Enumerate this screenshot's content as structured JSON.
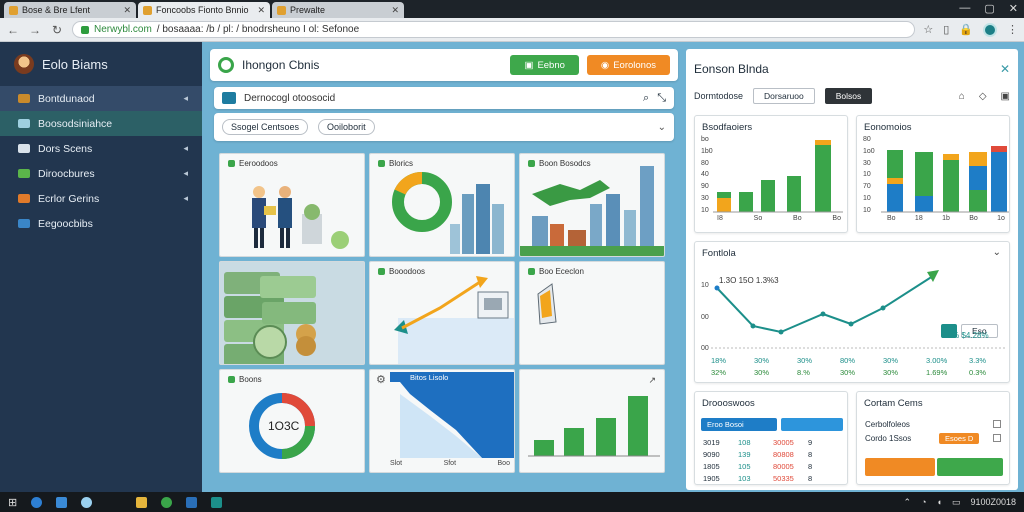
{
  "browser": {
    "tabs": [
      {
        "title": "Bose & Bre Lfent",
        "active": false
      },
      {
        "title": "Foncoobs Fionto Bnnio",
        "active": true
      },
      {
        "title": "Prewalte",
        "active": false
      }
    ],
    "url_host": "Nerwybl.com",
    "url_path": "/ bosaaaa: /b / pl: / bnodrsheuno I ol: Sefonoe"
  },
  "sidebar": {
    "brand": "Eolo Biams",
    "items": [
      {
        "label": "Bontdunaod",
        "icon_color": "#c98a2b",
        "state": "active",
        "chevron": true
      },
      {
        "label": "Boosodsiniahce",
        "icon_color": "#9fd0e0",
        "state": "selected",
        "chevron": false
      },
      {
        "label": "Dors Scens",
        "icon_color": "#d9e2ea",
        "state": "normal",
        "chevron": true
      },
      {
        "label": "Diroocbures",
        "icon_color": "#5bb54a",
        "state": "normal",
        "chevron": true
      },
      {
        "label": "Ecrlor Gerins",
        "icon_color": "#e07a2a",
        "state": "normal",
        "chevron": true
      },
      {
        "label": "Eegoocbibs",
        "icon_color": "#3a86c8",
        "state": "normal",
        "chevron": false
      }
    ]
  },
  "center": {
    "title": "Ihongon Cbnis",
    "btn_green": "Eebno",
    "btn_orange": "Eorolonos",
    "search_text": "Dernocogl otoosocid",
    "chips": [
      "Ssogel Centsoes",
      "Ooiloborit"
    ],
    "tiles": [
      {
        "label": "Eeroodoos"
      },
      {
        "label": "Blorics"
      },
      {
        "label": "Boon Bosodcs"
      },
      {
        "label": ""
      },
      {
        "label": "Booodoos"
      },
      {
        "label": "Boo Ececlon"
      },
      {
        "label": "Boons"
      },
      {
        "label": "Bitos Lisolo"
      },
      {
        "label": ""
      }
    ],
    "donut_center": "1O3C",
    "tile_axis": [
      "Slot",
      "Sfot",
      "Boo"
    ]
  },
  "right": {
    "title": "Eonson Blnda",
    "toolbar_label": "Dormtodose",
    "btn_outline": "Dorsaruoo",
    "btn_dark": "Bolsos",
    "card1": {
      "title": "Bsodfaoiers",
      "yticks": [
        "bo",
        "1b0",
        "80",
        "40",
        "90",
        "30",
        "10"
      ],
      "xticks": [
        "I8",
        "So",
        "Bo",
        "Bo"
      ]
    },
    "card2": {
      "title": "Eonomoios",
      "yticks": [
        "80",
        "1o0",
        "30",
        "10",
        "70",
        "10",
        "10"
      ],
      "xticks": [
        "Bo",
        "18",
        "1b",
        "Bo",
        "1o"
      ]
    },
    "card3": {
      "title": "Fontlola",
      "annot": "1.3O 15O 1.3%3",
      "badge": "Eso",
      "yticks": [
        "10",
        "00",
        "00"
      ],
      "right_label": "5.0% $4.28%",
      "rows": [
        [
          "18%",
          "30%",
          "30%",
          "80%",
          "30%",
          "3.00%",
          "3.3%"
        ],
        [
          "32%",
          "30%",
          "8.%",
          "30%",
          "30%",
          "1.69%",
          "0.3%"
        ]
      ]
    },
    "card4": {
      "title": "Droooswoos",
      "bar_label": "Eroo Bosoi",
      "rows": [
        [
          "3019",
          "108",
          "30005",
          "9"
        ],
        [
          "9090",
          "139",
          "80808",
          "8"
        ],
        [
          "1805",
          "105",
          "80005",
          "8"
        ],
        [
          "1905",
          "103",
          "50335",
          "8"
        ]
      ]
    },
    "card5": {
      "title": "Cortam Cems",
      "line1": "Cerbolfoleos",
      "line2": "Cordo 1Ssos",
      "pill": "Esoes D"
    }
  },
  "taskbar": {
    "clock": "9100Z0018",
    "tray_icons": 6
  },
  "colors": {
    "accent_green": "#3ea84b",
    "accent_orange": "#f08a24",
    "accent_blue": "#1e7dc7",
    "teal": "#1c8f8a",
    "sidebar_bg": "#22364f"
  }
}
